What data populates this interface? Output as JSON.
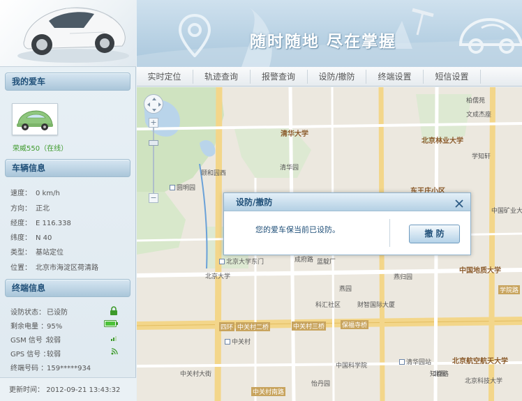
{
  "header": {
    "slogan": "随时随地  尽在掌握"
  },
  "tabs": [
    {
      "label": "实时定位"
    },
    {
      "label": "轨迹查询"
    },
    {
      "label": "报警查询"
    },
    {
      "label": "设防/撤防"
    },
    {
      "label": "终端设置"
    },
    {
      "label": "短信设置"
    }
  ],
  "sidebar": {
    "my_car_title": "我的爱车",
    "car_name": "荣威550（在线）",
    "vehicle_info_title": "车辆信息",
    "vehicle_info": [
      {
        "key": "速度：",
        "value": "0 km/h"
      },
      {
        "key": "方向：",
        "value": "正北"
      },
      {
        "key": "经度：",
        "value": "E 116.338"
      },
      {
        "key": "纬度：",
        "value": "N 40"
      },
      {
        "key": "类型：",
        "value": "基站定位"
      },
      {
        "key": "位置：",
        "value": "北京市海淀区荷清路"
      }
    ],
    "terminal_info_title": "终端信息",
    "terminal_info": [
      {
        "key": "设防状态：",
        "value": "已设防",
        "icon": "lock-icon"
      },
      {
        "key": "剩余电量  ：",
        "value": "95%",
        "icon": "battery-icon"
      },
      {
        "key": "GSM 信号  ：",
        "value": "较弱",
        "icon": "signal-icon"
      },
      {
        "key": "GPS 信号  ：",
        "value": "较弱",
        "icon": "satellite-icon"
      },
      {
        "key": "终端号码  ：",
        "value": "159*****934",
        "icon": ""
      }
    ],
    "update_label": "更新时间：",
    "update_time": "2012-09-21 13:43:32"
  },
  "dialog": {
    "title": "设防/撤防",
    "message": "您的爱车保当前已设防。",
    "button": "撤 防"
  },
  "map": {
    "labels": [
      "清华大学",
      "北京林业大学",
      "中国地质大学",
      "北京大学东门",
      "中关村",
      "清华园",
      "圆明园",
      "颐和园西",
      "蓝靛厂",
      "四环",
      "中关村二桥",
      "中关村三桥",
      "保福寺桥",
      "学院路",
      "北京航空航天大学",
      "燕园",
      "成府路",
      "东王庄小区",
      "柏儒苑",
      "文成杰座",
      "学知轩",
      "中国矿业大学",
      "北京大学",
      "科汇社区",
      "财智国际大厦",
      "中关村南路",
      "清华园站",
      "知春路",
      "北京科技大学",
      "中国科学院",
      "怡丹园",
      "燕归园",
      "北医",
      "中关村大街"
    ]
  },
  "colors": {
    "accent": "#1f4f78",
    "online_green": "#3d9a2a",
    "road_yellow": "#f3d68a"
  }
}
